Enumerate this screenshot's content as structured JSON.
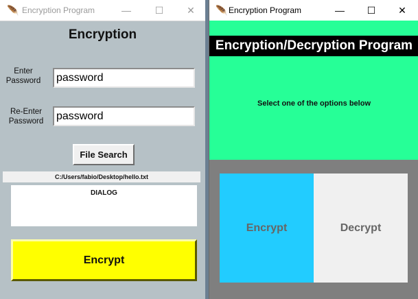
{
  "left_window": {
    "title": "Encryption Program",
    "heading": "Encryption",
    "enter_password_label": "Enter\nPassword",
    "enter_password_value": "password",
    "reenter_password_label": "Re-Enter\nPassword",
    "reenter_password_value": "password",
    "file_search_label": "File Search",
    "file_path": "C:/Users/fabio/Desktop/hello.txt",
    "dialog_label": "DIALOG",
    "encrypt_label": "Encrypt"
  },
  "right_window": {
    "title": "Encryption Program",
    "header": "Encryption/Decryption Program",
    "subtitle": "Select one of the options below",
    "encrypt_option": "Encrypt",
    "decrypt_option": "Decrypt"
  },
  "window_controls": {
    "minimize": "—",
    "maximize": "☐",
    "close": "✕"
  },
  "icons": {
    "app_icon": "feather-icon"
  },
  "colors": {
    "left_bg": "#b6c1c6",
    "green": "#26ff97",
    "header_bg": "#000000",
    "encrypt_blue": "#22ccff",
    "encrypt_yellow": "#ffff00",
    "right_bg": "#7f7f7f"
  }
}
